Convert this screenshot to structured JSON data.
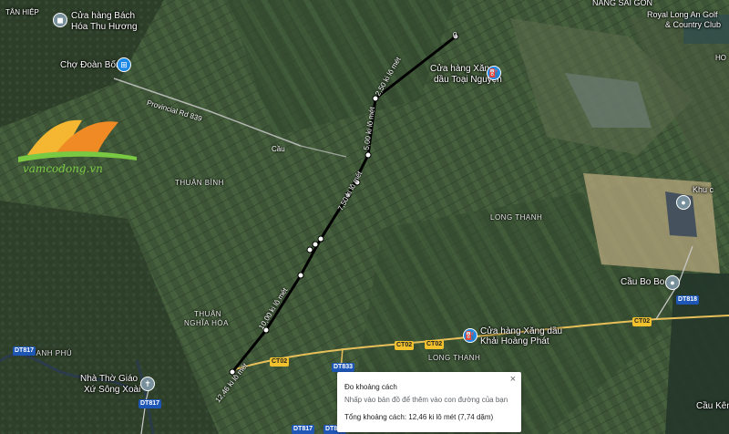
{
  "places": {
    "tan_hiep": "TÂN HIỆP",
    "bach_hoa_line1": "Cửa hàng Bách",
    "bach_hoa_line2": "Hóa Thu Hương",
    "cho_doan_bon": "Chợ Đoàn Bốn",
    "nang_sai_gon": "NĂNG SÀI GÒN",
    "golf_line1": "Royal Long An Golf",
    "golf_line2": "& Country Club",
    "xang_toai_line1": "Cửa hàng Xăng",
    "xang_toai_line2": "dầu Toại Nguyện",
    "thuan_binh": "THUẬN BÌNH",
    "cau": "Cầu",
    "long_thanh_1": "LONG THẠNH",
    "long_thanh_2": "LONG THẠNH",
    "khu_c": "Khu c",
    "cau_bo_bo": "Cầu Bo Bo",
    "xang_khai_line1": "Cửa hàng Xăng dầu",
    "xang_khai_line2": "Khải Hoàng Phát",
    "thuan_nghia_hoa_line1": "THUẬN",
    "thuan_nghia_hoa_line2": "NGHĨA HÒA",
    "thanh_phu": "THANH PHÚ",
    "nha_tho_line1": "Nhà Thờ Giáo",
    "nha_tho_line2": "Xứ Sông Xoài",
    "cau_ken": "Cầu Kên",
    "ho_partial": "HO"
  },
  "roads": {
    "provincial_839": "Provincial Rd 839",
    "ct02_a": "CT02",
    "ct02_b": "CT02",
    "ct02_c": "CT02",
    "ct02_d": "CT02",
    "dt817_a": "DT817",
    "dt817_b": "DT817",
    "dt817_c": "DT817",
    "dt833": "DT833",
    "dt833_b": "DT833",
    "dt818": "DT818"
  },
  "measure": {
    "labels": [
      "0",
      "2,50 ki lô mét",
      "5,00 ki lô mét",
      "7,50 ki lô mét",
      "10,00 ki lô mét",
      "12,46 ki lô mét"
    ],
    "route_color": "#000000"
  },
  "panel": {
    "title": "Đo khoảng cách",
    "hint": "Nhấp vào bản đồ để thêm vào con đường của bạn",
    "total": "Tổng khoảng cách: 12,46 ki lô mét (7,74 dặm)",
    "close": "×"
  },
  "logo": {
    "text": "vamcodong.vn"
  },
  "colors": {
    "ct_shield": "#f2c12e",
    "dt_shield": "#1d56b5",
    "poi_pin": "#1e88e5"
  }
}
